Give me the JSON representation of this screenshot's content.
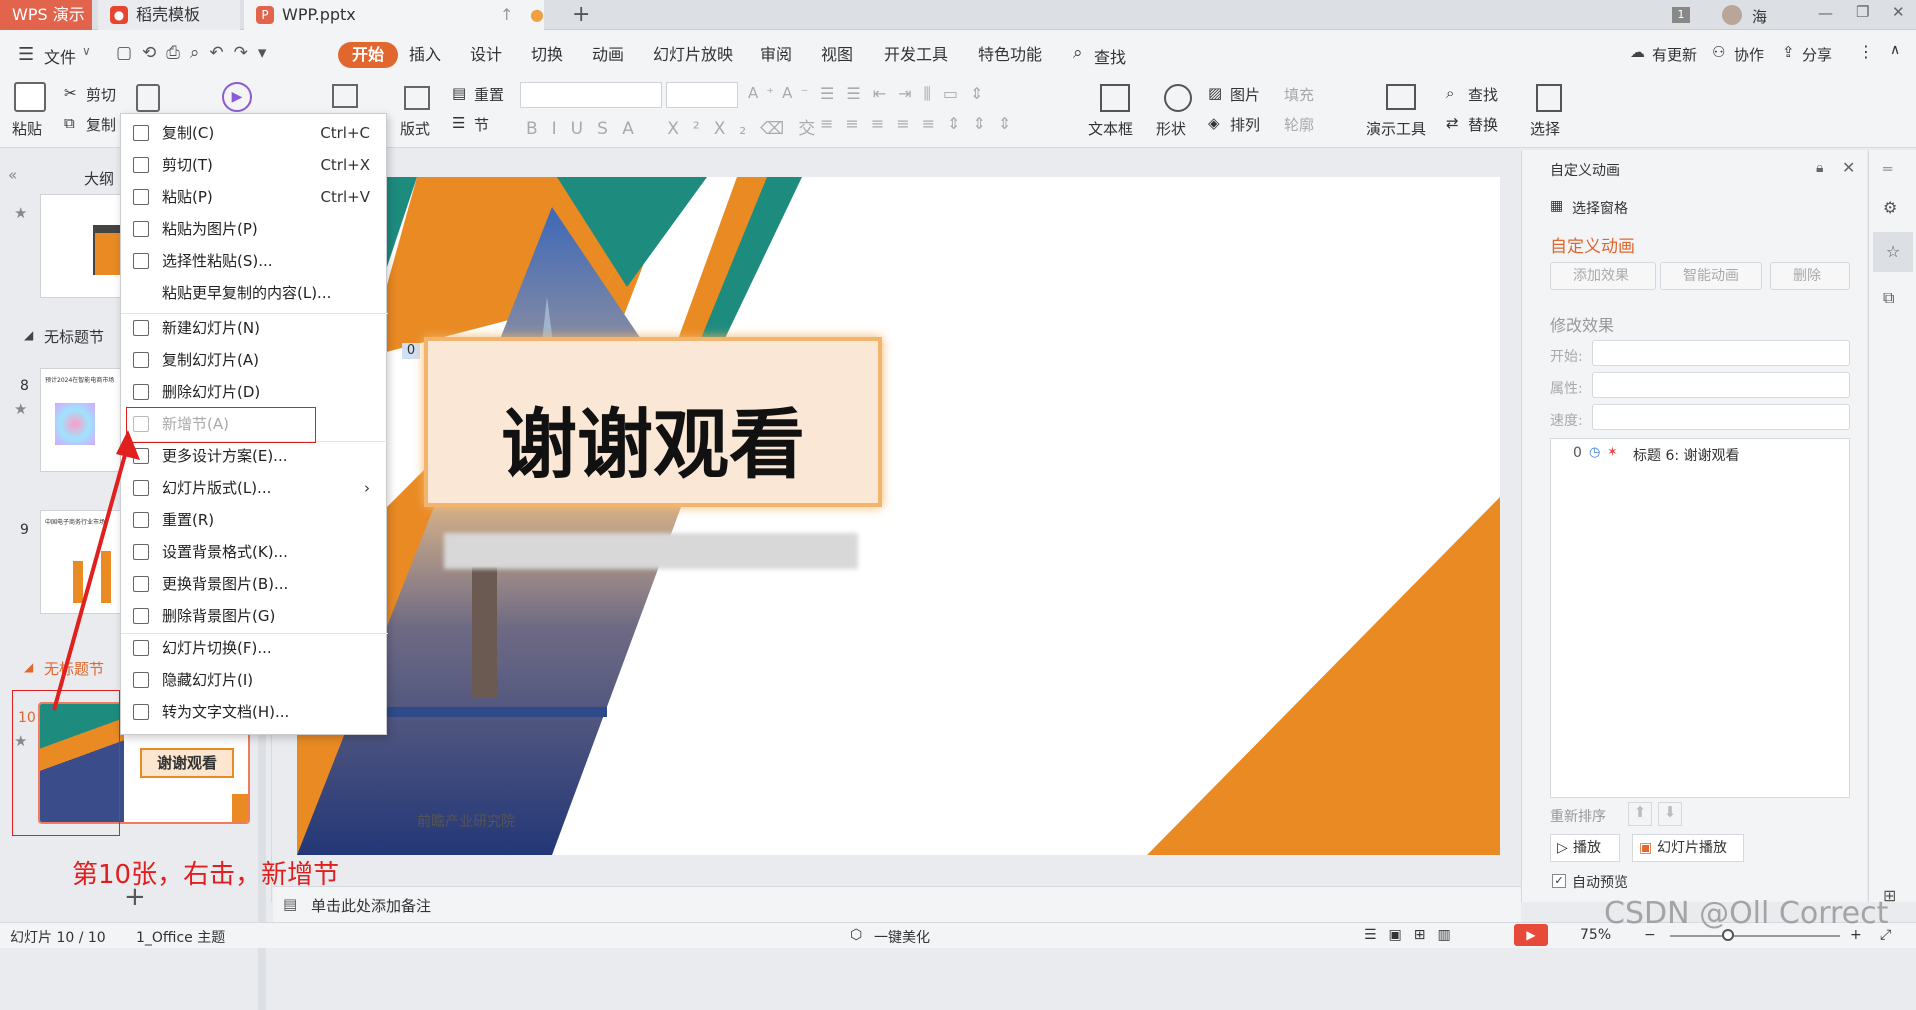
{
  "tabs": {
    "app": "WPS 演示",
    "template": "稻壳模板",
    "doc": "WPP.pptx",
    "page_badge": "1",
    "user": "海"
  },
  "menu": {
    "file": "文件",
    "items": [
      "开始",
      "插入",
      "设计",
      "切换",
      "动画",
      "幻灯片放映",
      "审阅",
      "视图",
      "开发工具",
      "特色功能"
    ],
    "search": "查找",
    "update": "有更新",
    "collab": "协作",
    "share": "分享"
  },
  "ribbon": {
    "paste": "粘贴",
    "cut": "剪切",
    "copy": "复制",
    "layout": "版式",
    "section": "节",
    "reset": "重置",
    "textbox": "文本框",
    "shape": "形状",
    "picture": "图片",
    "fill": "填充",
    "arrange": "排列",
    "outline": "轮廓",
    "present": "演示工具",
    "find": "查找",
    "replace": "替换",
    "select": "选择"
  },
  "leftpanel": {
    "outline_tab": "大纲",
    "section1": "无标题节",
    "section2": "无标题节",
    "slide8": "8",
    "slide9": "9",
    "slide10": "10",
    "thumb8_title": "预计2024在智能电商市场",
    "thumb9_title": "中国电子商务行业市场",
    "thumb10_text": "谢谢观看"
  },
  "context_menu": [
    {
      "label": "复制(C)",
      "shortcut": "Ctrl+C"
    },
    {
      "label": "剪切(T)",
      "shortcut": "Ctrl+X"
    },
    {
      "label": "粘贴(P)",
      "shortcut": "Ctrl+V"
    },
    {
      "label": "粘贴为图片(P)",
      "shortcut": ""
    },
    {
      "label": "选择性粘贴(S)...",
      "shortcut": ""
    },
    {
      "label": "粘贴更早复制的内容(L)...",
      "shortcut": ""
    },
    {
      "label": "新建幻灯片(N)",
      "shortcut": ""
    },
    {
      "label": "复制幻灯片(A)",
      "shortcut": ""
    },
    {
      "label": "删除幻灯片(D)",
      "shortcut": ""
    },
    {
      "label": "新增节(A)",
      "shortcut": ""
    },
    {
      "label": "更多设计方案(E)...",
      "shortcut": ""
    },
    {
      "label": "幻灯片版式(L)...",
      "shortcut": ""
    },
    {
      "label": "重置(R)",
      "shortcut": ""
    },
    {
      "label": "设置背景格式(K)...",
      "shortcut": ""
    },
    {
      "label": "更换背景图片(B)...",
      "shortcut": ""
    },
    {
      "label": "删除背景图片(G)",
      "shortcut": ""
    },
    {
      "label": "幻灯片切换(F)...",
      "shortcut": ""
    },
    {
      "label": "隐藏幻灯片(I)",
      "shortcut": ""
    },
    {
      "label": "转为文字文档(H)...",
      "shortcut": ""
    }
  ],
  "slide": {
    "title": "谢谢观看",
    "footer": "前瞻产业研究院",
    "anim_tag": "0"
  },
  "rightpane": {
    "header": "自定义动画",
    "select_pane": "选择窗格",
    "title": "自定义动画",
    "add_effect": "添加效果",
    "smart_anim": "智能动画",
    "delete": "删除",
    "modify": "修改效果",
    "start": "开始:",
    "property": "属性:",
    "speed": "速度:",
    "list_item_num": "0",
    "list_item": "标题 6: 谢谢观看",
    "reorder": "重新排序",
    "play": "播放",
    "slideshow": "幻灯片播放",
    "auto_preview": "自动预览"
  },
  "notes": "单击此处添加备注",
  "status": {
    "slide_count": "幻灯片 10 / 10",
    "theme": "1_Office 主题",
    "beautify": "一键美化",
    "zoom": "75%"
  },
  "annotation": "第10张，右击，新增节",
  "watermark": "CSDN @Oll Correct"
}
